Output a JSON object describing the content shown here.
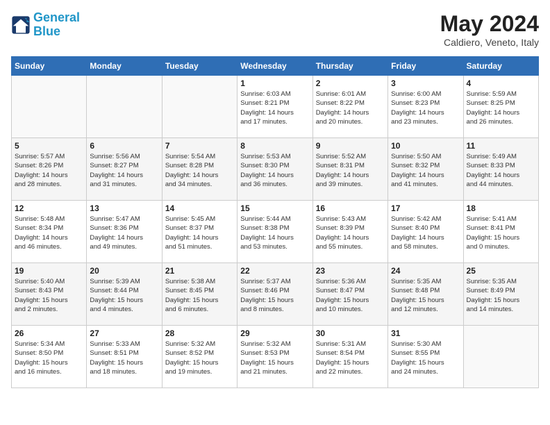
{
  "header": {
    "logo_line1": "General",
    "logo_line2": "Blue",
    "month": "May 2024",
    "location": "Caldiero, Veneto, Italy"
  },
  "weekdays": [
    "Sunday",
    "Monday",
    "Tuesday",
    "Wednesday",
    "Thursday",
    "Friday",
    "Saturday"
  ],
  "weeks": [
    [
      {
        "day": "",
        "info": ""
      },
      {
        "day": "",
        "info": ""
      },
      {
        "day": "",
        "info": ""
      },
      {
        "day": "1",
        "info": "Sunrise: 6:03 AM\nSunset: 8:21 PM\nDaylight: 14 hours\nand 17 minutes."
      },
      {
        "day": "2",
        "info": "Sunrise: 6:01 AM\nSunset: 8:22 PM\nDaylight: 14 hours\nand 20 minutes."
      },
      {
        "day": "3",
        "info": "Sunrise: 6:00 AM\nSunset: 8:23 PM\nDaylight: 14 hours\nand 23 minutes."
      },
      {
        "day": "4",
        "info": "Sunrise: 5:59 AM\nSunset: 8:25 PM\nDaylight: 14 hours\nand 26 minutes."
      }
    ],
    [
      {
        "day": "5",
        "info": "Sunrise: 5:57 AM\nSunset: 8:26 PM\nDaylight: 14 hours\nand 28 minutes."
      },
      {
        "day": "6",
        "info": "Sunrise: 5:56 AM\nSunset: 8:27 PM\nDaylight: 14 hours\nand 31 minutes."
      },
      {
        "day": "7",
        "info": "Sunrise: 5:54 AM\nSunset: 8:28 PM\nDaylight: 14 hours\nand 34 minutes."
      },
      {
        "day": "8",
        "info": "Sunrise: 5:53 AM\nSunset: 8:30 PM\nDaylight: 14 hours\nand 36 minutes."
      },
      {
        "day": "9",
        "info": "Sunrise: 5:52 AM\nSunset: 8:31 PM\nDaylight: 14 hours\nand 39 minutes."
      },
      {
        "day": "10",
        "info": "Sunrise: 5:50 AM\nSunset: 8:32 PM\nDaylight: 14 hours\nand 41 minutes."
      },
      {
        "day": "11",
        "info": "Sunrise: 5:49 AM\nSunset: 8:33 PM\nDaylight: 14 hours\nand 44 minutes."
      }
    ],
    [
      {
        "day": "12",
        "info": "Sunrise: 5:48 AM\nSunset: 8:34 PM\nDaylight: 14 hours\nand 46 minutes."
      },
      {
        "day": "13",
        "info": "Sunrise: 5:47 AM\nSunset: 8:36 PM\nDaylight: 14 hours\nand 49 minutes."
      },
      {
        "day": "14",
        "info": "Sunrise: 5:45 AM\nSunset: 8:37 PM\nDaylight: 14 hours\nand 51 minutes."
      },
      {
        "day": "15",
        "info": "Sunrise: 5:44 AM\nSunset: 8:38 PM\nDaylight: 14 hours\nand 53 minutes."
      },
      {
        "day": "16",
        "info": "Sunrise: 5:43 AM\nSunset: 8:39 PM\nDaylight: 14 hours\nand 55 minutes."
      },
      {
        "day": "17",
        "info": "Sunrise: 5:42 AM\nSunset: 8:40 PM\nDaylight: 14 hours\nand 58 minutes."
      },
      {
        "day": "18",
        "info": "Sunrise: 5:41 AM\nSunset: 8:41 PM\nDaylight: 15 hours\nand 0 minutes."
      }
    ],
    [
      {
        "day": "19",
        "info": "Sunrise: 5:40 AM\nSunset: 8:43 PM\nDaylight: 15 hours\nand 2 minutes."
      },
      {
        "day": "20",
        "info": "Sunrise: 5:39 AM\nSunset: 8:44 PM\nDaylight: 15 hours\nand 4 minutes."
      },
      {
        "day": "21",
        "info": "Sunrise: 5:38 AM\nSunset: 8:45 PM\nDaylight: 15 hours\nand 6 minutes."
      },
      {
        "day": "22",
        "info": "Sunrise: 5:37 AM\nSunset: 8:46 PM\nDaylight: 15 hours\nand 8 minutes."
      },
      {
        "day": "23",
        "info": "Sunrise: 5:36 AM\nSunset: 8:47 PM\nDaylight: 15 hours\nand 10 minutes."
      },
      {
        "day": "24",
        "info": "Sunrise: 5:35 AM\nSunset: 8:48 PM\nDaylight: 15 hours\nand 12 minutes."
      },
      {
        "day": "25",
        "info": "Sunrise: 5:35 AM\nSunset: 8:49 PM\nDaylight: 15 hours\nand 14 minutes."
      }
    ],
    [
      {
        "day": "26",
        "info": "Sunrise: 5:34 AM\nSunset: 8:50 PM\nDaylight: 15 hours\nand 16 minutes."
      },
      {
        "day": "27",
        "info": "Sunrise: 5:33 AM\nSunset: 8:51 PM\nDaylight: 15 hours\nand 18 minutes."
      },
      {
        "day": "28",
        "info": "Sunrise: 5:32 AM\nSunset: 8:52 PM\nDaylight: 15 hours\nand 19 minutes."
      },
      {
        "day": "29",
        "info": "Sunrise: 5:32 AM\nSunset: 8:53 PM\nDaylight: 15 hours\nand 21 minutes."
      },
      {
        "day": "30",
        "info": "Sunrise: 5:31 AM\nSunset: 8:54 PM\nDaylight: 15 hours\nand 22 minutes."
      },
      {
        "day": "31",
        "info": "Sunrise: 5:30 AM\nSunset: 8:55 PM\nDaylight: 15 hours\nand 24 minutes."
      },
      {
        "day": "",
        "info": ""
      }
    ]
  ]
}
